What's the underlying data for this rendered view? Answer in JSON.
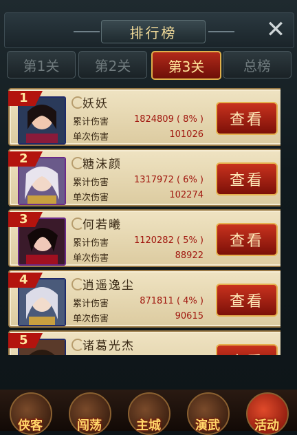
{
  "header": {
    "title": "排行榜",
    "close_icon": "close-icon"
  },
  "tabs": [
    {
      "label": "第1关",
      "active": false
    },
    {
      "label": "第2关",
      "active": false
    },
    {
      "label": "第3关",
      "active": true
    },
    {
      "label": "总榜",
      "active": false
    }
  ],
  "labels": {
    "total_damage": "累计伤害",
    "single_damage": "单次伤害",
    "view": "查看"
  },
  "rankings": [
    {
      "rank": "1",
      "name": "妖妖",
      "total": "1824809 ( 8% )",
      "single": "101026",
      "avatar_icon": "hero-portrait-icon"
    },
    {
      "rank": "2",
      "name": "糖沫颜",
      "total": "1317972 ( 6% )",
      "single": "102274",
      "avatar_icon": "hero-portrait-icon"
    },
    {
      "rank": "3",
      "name": "何若曦",
      "total": "1120282 ( 5% )",
      "single": "88922",
      "avatar_icon": "hero-portrait-icon"
    },
    {
      "rank": "4",
      "name": "逍遥逸尘",
      "total": "871811 ( 4% )",
      "single": "90615",
      "avatar_icon": "hero-portrait-icon"
    },
    {
      "rank": "5",
      "name": "诸葛光杰",
      "total": "",
      "single": "",
      "avatar_icon": "hero-portrait-icon"
    }
  ],
  "bottom_nav": [
    {
      "label": "侠客",
      "icon": "hero-icon"
    },
    {
      "label": "闯荡",
      "icon": "adventure-icon"
    },
    {
      "label": "主城",
      "icon": "city-icon"
    },
    {
      "label": "演武",
      "icon": "martial-icon"
    },
    {
      "label": "活动",
      "icon": "lantern-icon"
    }
  ],
  "colors": {
    "accent_red": "#b3140e",
    "gold": "#e6b04e",
    "parchment": "#efe3c2"
  }
}
